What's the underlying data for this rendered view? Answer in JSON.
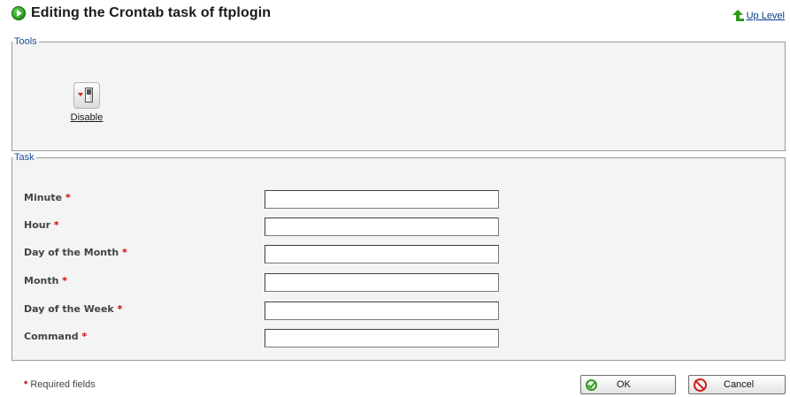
{
  "header": {
    "title": "Editing the Crontab task of ftplogin",
    "title_icon": "play-icon",
    "up_level_label": "Up Level",
    "up_level_icon": "up-arrow-icon"
  },
  "tools": {
    "legend": "Tools",
    "disable": {
      "label": "Disable",
      "icon": "switch-off-icon"
    }
  },
  "task": {
    "legend": "Task",
    "fields": [
      {
        "label": "Minute",
        "required": "*",
        "value": "",
        "placeholder": ""
      },
      {
        "label": "Hour",
        "required": "*",
        "value": "",
        "placeholder": ""
      },
      {
        "label": "Day of the Month",
        "required": "*",
        "value": "",
        "placeholder": ""
      },
      {
        "label": "Month",
        "required": "*",
        "value": "",
        "placeholder": ""
      },
      {
        "label": "Day of the Week",
        "required": "*",
        "value": "",
        "placeholder": ""
      },
      {
        "label": "Command",
        "required": "*",
        "value": "",
        "placeholder": ""
      }
    ]
  },
  "footer": {
    "required_marker": "*",
    "required_note": " Required fields",
    "ok_label": "OK",
    "ok_icon": "check-circle-icon",
    "cancel_label": "Cancel",
    "cancel_icon": "no-entry-icon"
  },
  "colors": {
    "legend_text": "#1a4f9c",
    "required_star": "#cc0000",
    "link": "#003c8c",
    "ok_green": "#2e9a1c",
    "cancel_red": "#d11b1b"
  }
}
